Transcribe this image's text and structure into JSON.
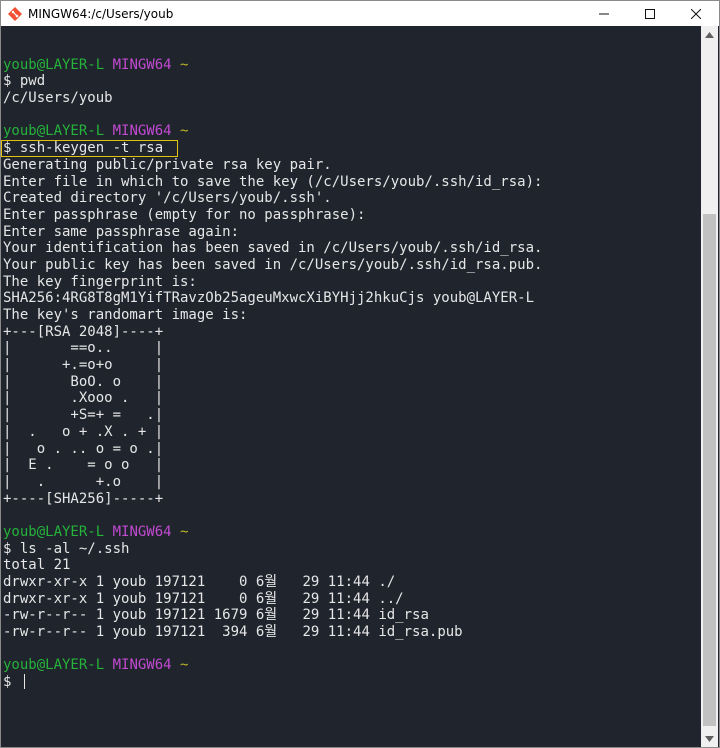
{
  "window": {
    "title": "MINGW64:/c/Users/youb",
    "controls": {
      "minimize": "—",
      "maximize": "☐",
      "close": "✕"
    }
  },
  "terminal": {
    "prompt": {
      "user": "youb@LAYER-L",
      "host": "MINGW64",
      "dir": "~"
    },
    "lines": [
      {
        "type": "blank",
        "text": ""
      },
      {
        "type": "prompt"
      },
      {
        "type": "cmd",
        "text": "$ pwd"
      },
      {
        "type": "out",
        "text": "/c/Users/youb"
      },
      {
        "type": "blank",
        "text": ""
      },
      {
        "type": "prompt"
      },
      {
        "type": "cmd",
        "text": "$ ssh-keygen -t rsa",
        "highlight": true
      },
      {
        "type": "out",
        "text": "Generating public/private rsa key pair."
      },
      {
        "type": "out",
        "text": "Enter file in which to save the key (/c/Users/youb/.ssh/id_rsa):"
      },
      {
        "type": "out",
        "text": "Created directory '/c/Users/youb/.ssh'."
      },
      {
        "type": "out",
        "text": "Enter passphrase (empty for no passphrase):"
      },
      {
        "type": "out",
        "text": "Enter same passphrase again:"
      },
      {
        "type": "out",
        "text": "Your identification has been saved in /c/Users/youb/.ssh/id_rsa."
      },
      {
        "type": "out",
        "text": "Your public key has been saved in /c/Users/youb/.ssh/id_rsa.pub."
      },
      {
        "type": "out",
        "text": "The key fingerprint is:"
      },
      {
        "type": "out",
        "text": "SHA256:4RG8T8gM1YifTRavzOb25ageuMxwcXiBYHjj2hkuCjs youb@LAYER-L"
      },
      {
        "type": "out",
        "text": "The key's randomart image is:"
      },
      {
        "type": "out",
        "text": "+---[RSA 2048]----+"
      },
      {
        "type": "out",
        "text": "|       ==o..     |"
      },
      {
        "type": "out",
        "text": "|      +.=o+o     |"
      },
      {
        "type": "out",
        "text": "|       BoO. o    |"
      },
      {
        "type": "out",
        "text": "|       .Xooo .   |"
      },
      {
        "type": "out",
        "text": "|       +S=+ =   .|"
      },
      {
        "type": "out",
        "text": "|  .   o + .X . + |"
      },
      {
        "type": "out",
        "text": "|   o . .. o = o .|"
      },
      {
        "type": "out",
        "text": "|  E .    = o o   |"
      },
      {
        "type": "out",
        "text": "|   .      +.o    |"
      },
      {
        "type": "out",
        "text": "+----[SHA256]-----+"
      },
      {
        "type": "blank",
        "text": ""
      },
      {
        "type": "prompt"
      },
      {
        "type": "cmd",
        "text": "$ ls -al ~/.ssh"
      },
      {
        "type": "out",
        "text": "total 21"
      },
      {
        "type": "out",
        "text": "drwxr-xr-x 1 youb 197121    0 6월   29 11:44 ./"
      },
      {
        "type": "out",
        "text": "drwxr-xr-x 1 youb 197121    0 6월   29 11:44 ../"
      },
      {
        "type": "out",
        "text": "-rw-r--r-- 1 youb 197121 1679 6월   29 11:44 id_rsa"
      },
      {
        "type": "out",
        "text": "-rw-r--r-- 1 youb 197121  394 6월   29 11:44 id_rsa.pub"
      },
      {
        "type": "blank",
        "text": ""
      },
      {
        "type": "prompt"
      },
      {
        "type": "input",
        "text": "$ "
      }
    ]
  },
  "scrollbar": {
    "up_icon": "triangle-up-icon",
    "down_icon": "triangle-down-icon",
    "scroll_position": 0.27
  }
}
